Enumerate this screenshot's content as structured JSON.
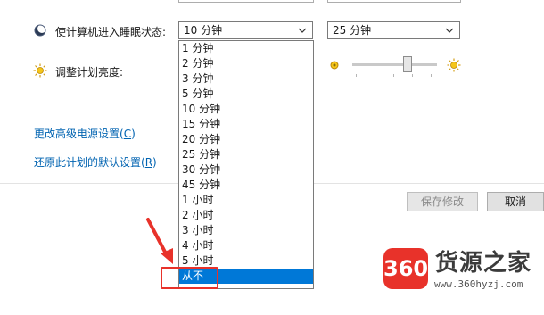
{
  "sleep": {
    "label": "使计算机进入睡眠状态:",
    "on_battery_value": "10 分钟",
    "plugged_in_value": "25 分钟"
  },
  "brightness": {
    "label": "调整计划亮度:"
  },
  "links": {
    "advanced": "更改高级电源设置",
    "advanced_key": "C",
    "restore": "还原此计划的默认设置",
    "restore_key": "R"
  },
  "buttons": {
    "save": "保存修改",
    "cancel": "取消"
  },
  "dropdown": {
    "options": [
      "1 分钟",
      "2 分钟",
      "3 分钟",
      "5 分钟",
      "10 分钟",
      "15 分钟",
      "20 分钟",
      "25 分钟",
      "30 分钟",
      "45 分钟",
      "1 小时",
      "2 小时",
      "3 小时",
      "4 小时",
      "5 小时",
      "从不"
    ],
    "highlighted": "从不"
  },
  "watermark": {
    "logo_text": "360",
    "title": "货源之家",
    "url": "www.360hyzj.com"
  },
  "colors": {
    "selection": "#0078d7",
    "annotation": "#e8322a",
    "link": "#0063b1"
  }
}
